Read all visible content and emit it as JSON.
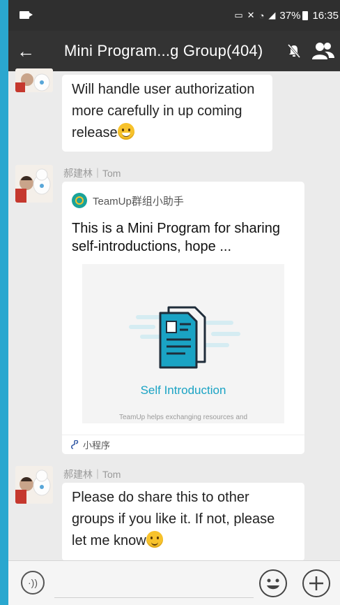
{
  "status_bar": {
    "battery": "37%",
    "time": "16:35"
  },
  "header": {
    "title": "Mini Program...g Group(404)"
  },
  "messages": [
    {
      "text_lines": [
        "Will handle user authorization",
        "more carefully in up coming",
        "release"
      ]
    },
    {
      "sender": "郝建林｜Tom",
      "card": {
        "app_name": "TeamUp群组小助手",
        "title": "This is a Mini Program for sharing self-introductions, hope ...",
        "image_caption": "Self Introduction",
        "image_subtext": "TeamUp helps exchanging resources and",
        "footer_label": "小程序"
      }
    },
    {
      "sender": "郝建林｜Tom",
      "text_lines": [
        "Please do share this to other",
        "groups if you like it. If not, please",
        "let me know"
      ]
    }
  ],
  "colors": {
    "accent": "#1aa3c4",
    "title_bar": "#333333",
    "chat_bg": "#ebebeb"
  }
}
